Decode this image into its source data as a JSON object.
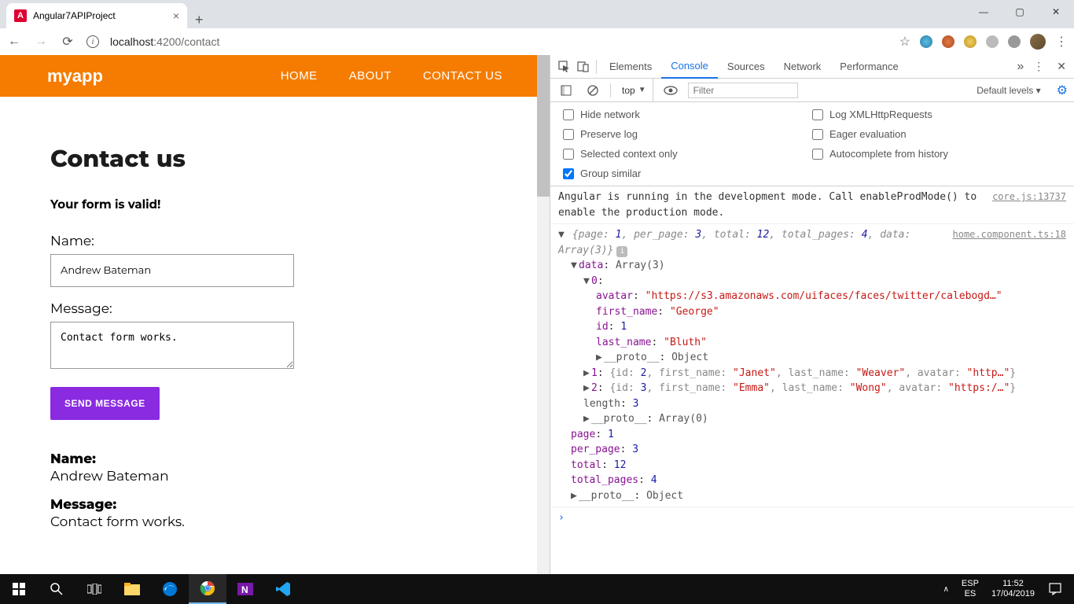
{
  "browser": {
    "tab_title": "Angular7APIProject",
    "url_host": "localhost",
    "url_port_path": ":4200/contact"
  },
  "window_controls": {
    "min": "—",
    "max": "▢",
    "close": "✕"
  },
  "app": {
    "logo": "myapp",
    "nav": {
      "home": "HOME",
      "about": "ABOUT",
      "contact": "CONTACT US"
    },
    "heading": "Contact us",
    "valid_msg": "Your form is valid!",
    "labels": {
      "name": "Name:",
      "message": "Message:"
    },
    "values": {
      "name": "Andrew Bateman",
      "message": "Contact form works."
    },
    "send_btn": "SEND MESSAGE",
    "result": {
      "name_label": "Name:",
      "name_value": "Andrew Bateman",
      "msg_label": "Message:",
      "msg_value": "Contact form works."
    }
  },
  "devtools": {
    "tabs": {
      "elements": "Elements",
      "console": "Console",
      "sources": "Sources",
      "network": "Network",
      "performance": "Performance"
    },
    "context": "top",
    "filter_placeholder": "Filter",
    "levels": "Default levels ▾",
    "checks": {
      "hide_net": "Hide network",
      "log_xhr": "Log XMLHttpRequests",
      "preserve": "Preserve log",
      "eager": "Eager evaluation",
      "selected_ctx": "Selected context only",
      "autocomplete": "Autocomplete from history",
      "group": "Group similar"
    },
    "msg1": "Angular is running in the development mode. Call enableProdMode() to enable the production mode.",
    "msg1_src": "core.js:13737",
    "msg2_src": "home.component.ts:18",
    "response": {
      "page": 1,
      "per_page": 3,
      "total": 12,
      "total_pages": 4,
      "data_label": "Array(3)",
      "data": [
        {
          "id": 1,
          "first_name": "George",
          "last_name": "Bluth",
          "avatar": "https://s3.amazonaws.com/uifaces/faces/twitter/calebogd…"
        },
        {
          "id": 2,
          "first_name": "Janet",
          "last_name": "Weaver",
          "avatar": "http…"
        },
        {
          "id": 3,
          "first_name": "Emma",
          "last_name": "Wong",
          "avatar": "https:/…"
        }
      ],
      "length": 3,
      "proto_arr": "Array(0)",
      "proto_obj": "Object"
    }
  },
  "taskbar": {
    "lang_top": "ESP",
    "lang_bot": "ES",
    "time": "11:52",
    "date": "17/04/2019"
  }
}
